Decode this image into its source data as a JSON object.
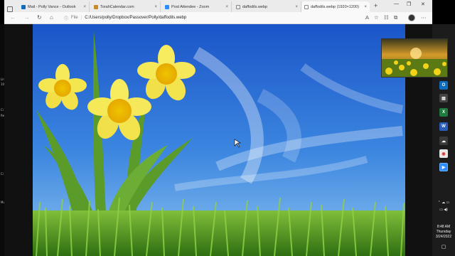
{
  "browser": {
    "tabs": [
      {
        "label": "Mail - Polly Vance - Outlook",
        "favicon": "outlook-icon",
        "color": "#0f6cbd"
      },
      {
        "label": "TorahCalendar.com",
        "favicon": "torah-calendar-icon",
        "color": "#c98a2a"
      },
      {
        "label": "Post Attendee - Zoom",
        "favicon": "zoom-icon",
        "color": "#2d8cff"
      },
      {
        "label": "daffodils.webp",
        "favicon": "file-icon",
        "color": "#888888"
      },
      {
        "label": "daffodils.webp (1920×1200)",
        "favicon": "file-icon",
        "color": "#888888"
      }
    ],
    "address": {
      "scheme_label": "File",
      "url": "C:/Users/polly/Dropbox/Passover/Polly/daffodils.webp"
    }
  },
  "taskbar": {
    "time": "8:48 AM",
    "day": "Thursday",
    "date": "3/24/2022"
  },
  "left_strip": {
    "fragments": [
      "Lin",
      "10",
      "Ci",
      "Re",
      "Ci",
      "Mu"
    ]
  }
}
